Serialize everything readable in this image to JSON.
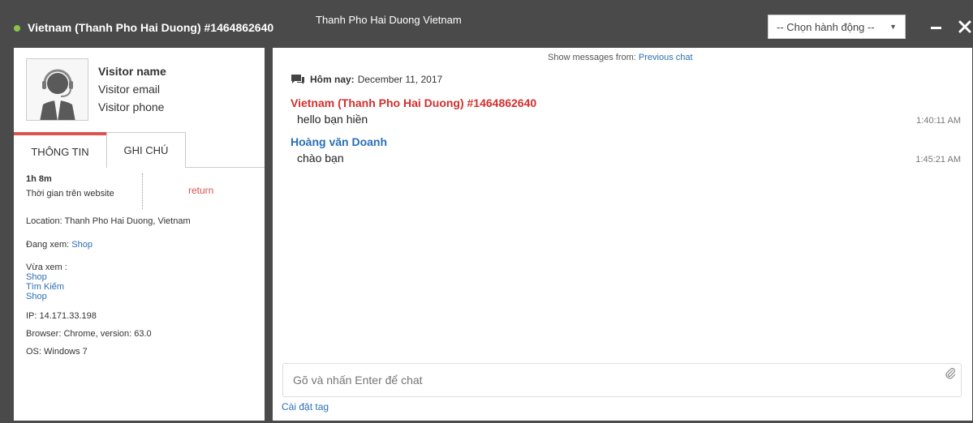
{
  "header": {
    "title": "Vietnam (Thanh Pho Hai Duong) #1464862640",
    "center_title": "Thanh Pho Hai Duong Vietnam",
    "action_select": "-- Chọn hành động --",
    "status_color": "#8bc34a"
  },
  "visitor": {
    "name": "Visitor name",
    "email": "Visitor email",
    "phone": "Visitor phone"
  },
  "tabs": {
    "info": "THÔNG TIN",
    "notes": "GHI CHÚ"
  },
  "info": {
    "time_value": "1h 8m",
    "time_label": "Thời gian trên website",
    "return_label": "return",
    "location": "Location: Thanh Pho Hai Duong, Vietnam",
    "viewing_label": "Đang xem:",
    "viewing_link": "Shop",
    "recent_label": "Vừa xem :",
    "recent_links": [
      "Shop",
      "Tìm Kiếm",
      "Shop"
    ],
    "ip": "IP: 14.171.33.198",
    "browser": "Browser: Chrome, version: 63.0",
    "os": "OS: Windows 7"
  },
  "chat": {
    "show_messages_label": "Show messages from:",
    "previous_chat": "Previous chat",
    "today_label": "Hôm nay:",
    "date": "December 11, 2017",
    "messages": [
      {
        "sender": "Vietnam (Thanh Pho Hai Duong) #1464862640",
        "text": "hello bạn hiền",
        "time": "1:40:11 AM"
      },
      {
        "sender": "Hoàng văn Doanh",
        "text": "chào bạn",
        "time": "1:45:21 AM"
      }
    ],
    "input_placeholder": "Gõ và nhấn Enter để chat",
    "tag_settings": "Cài đặt tag"
  },
  "colors": {
    "accent_red": "#d9534f",
    "visitor_red": "#d32f2f",
    "agent_blue": "#2a6fb5",
    "header_bg": "#4a4a4a"
  }
}
